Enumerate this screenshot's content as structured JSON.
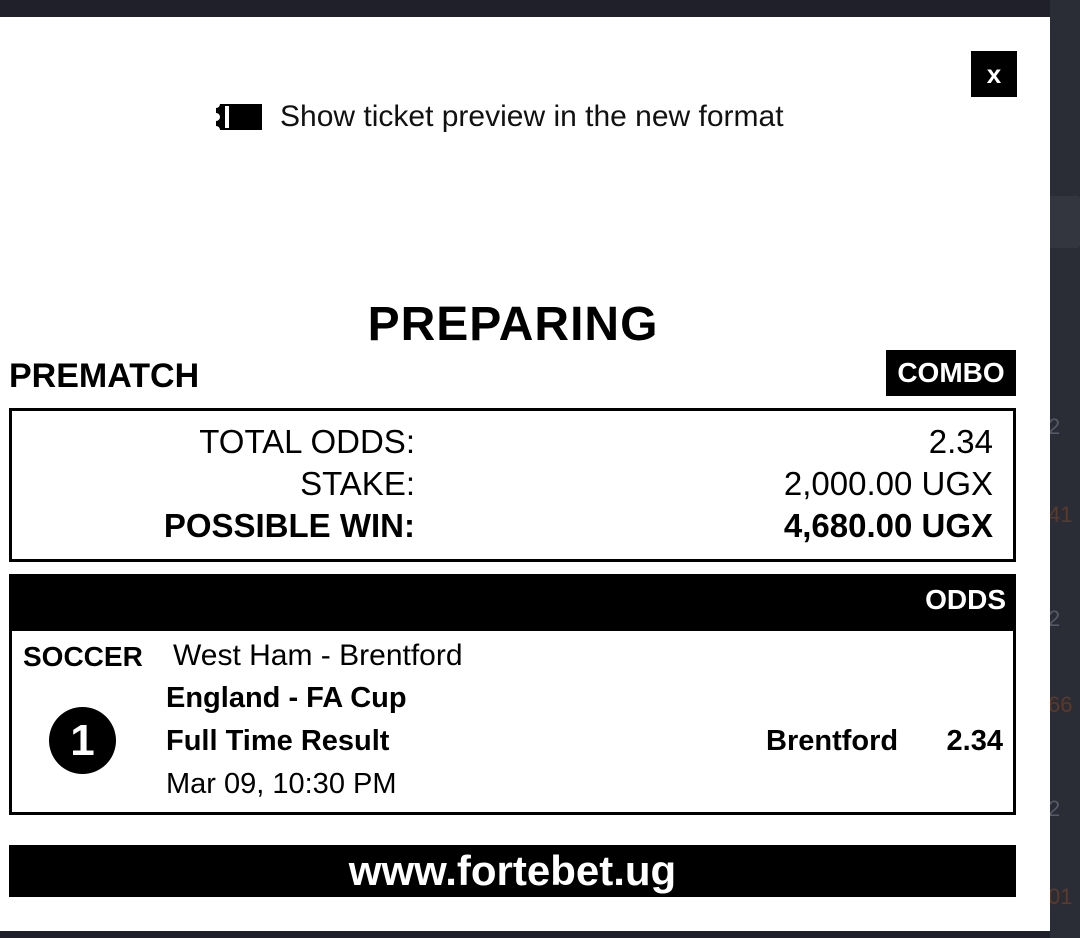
{
  "modal": {
    "close_label": "x",
    "preview_link_text": "Show ticket preview in the new format",
    "icons": {
      "preview": "ticket-icon",
      "close": "close-icon"
    }
  },
  "ticket": {
    "status": "PREPARING",
    "bet_kind": "PREMATCH",
    "bet_type": "COMBO",
    "summary": {
      "total_odds_label": "TOTAL ODDS:",
      "total_odds_value": "2.34",
      "stake_label": "STAKE:",
      "stake_value": "2,000.00 UGX",
      "possible_win_label": "POSSIBLE WIN:",
      "possible_win_value": "4,680.00 UGX"
    },
    "odds_header": "ODDS",
    "selection": {
      "sport": "SOCCER",
      "match": "West Ham - Brentford",
      "league": "England - FA Cup",
      "market": "Full Time Result",
      "datetime": "Mar 09, 10:30 PM",
      "index": "1",
      "pick": "Brentford",
      "odd": "2.34"
    },
    "website": "www.fortebet.ug"
  },
  "background": {
    "partial_values": [
      "2",
      "41",
      "2",
      "66",
      "2",
      "01"
    ]
  },
  "colors": {
    "page_bg": "#1f2029",
    "modal_bg": "#ffffff",
    "ink": "#000000"
  }
}
